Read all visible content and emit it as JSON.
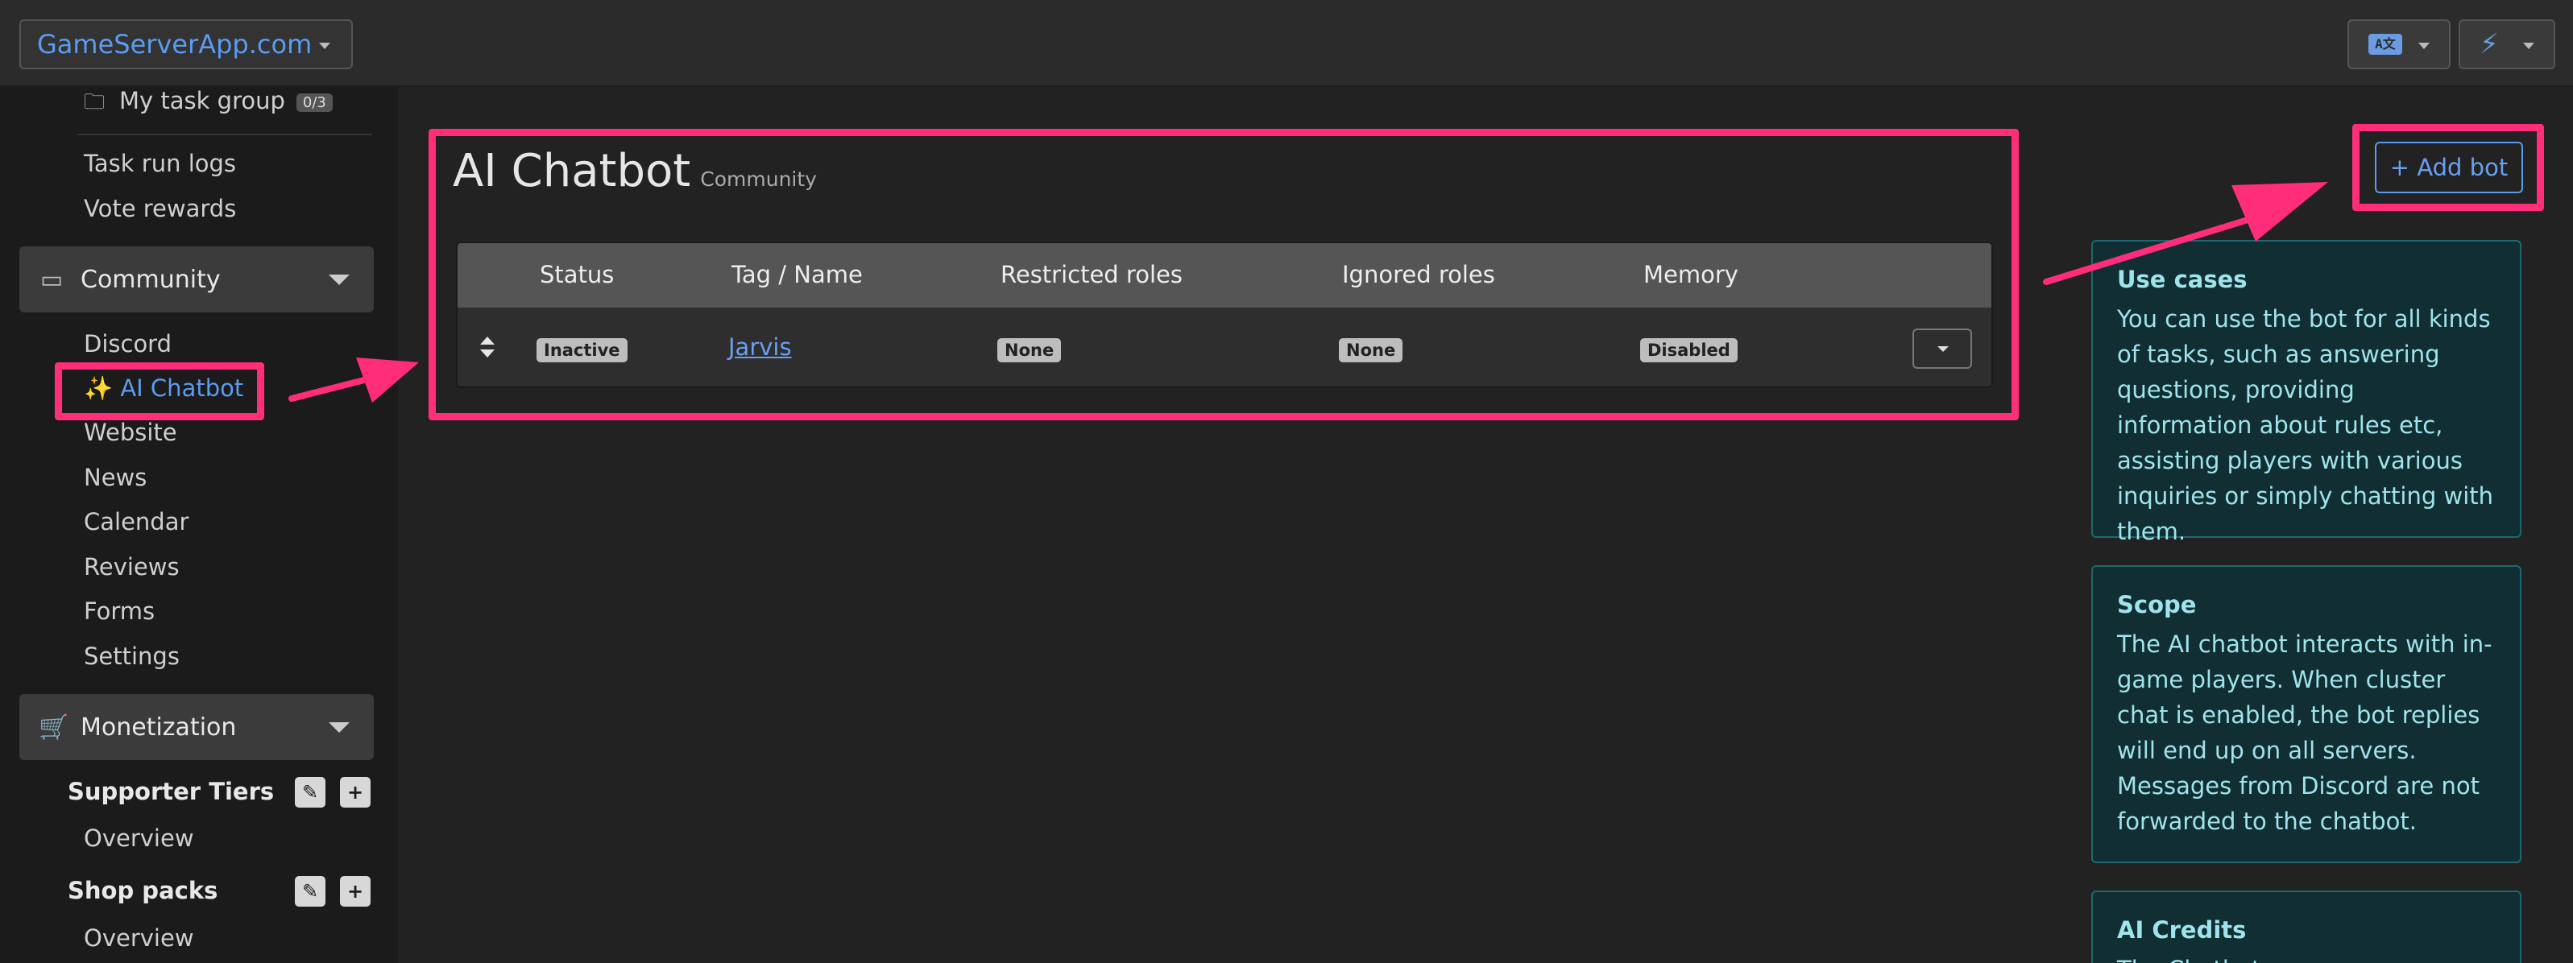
{
  "topbar": {
    "brand": "GameServerApp.com",
    "lang_icon": "translate-icon",
    "tools_icon": "magic-wand-icon"
  },
  "sidebar": {
    "task_group": {
      "label": "My task group",
      "badge": "0/3"
    },
    "items_top": [
      "Task run logs",
      "Vote rewards"
    ],
    "community": {
      "label": "Community",
      "items": [
        "Discord",
        "✨ AI Chatbot",
        "Website",
        "News",
        "Calendar",
        "Reviews",
        "Forms",
        "Settings"
      ]
    },
    "monetization": {
      "label": "Monetization",
      "supporter_tiers": {
        "label": "Supporter Tiers",
        "overview": "Overview"
      },
      "shop_packs": {
        "label": "Shop packs",
        "overview": "Overview"
      }
    }
  },
  "main": {
    "title": "AI Chatbot",
    "subtitle": "Community",
    "add_bot": "+ Add bot",
    "table": {
      "headers": [
        "Status",
        "Tag / Name",
        "Restricted roles",
        "Ignored roles",
        "Memory"
      ],
      "rows": [
        {
          "status": "Inactive",
          "name": "Jarvis",
          "restricted_roles": "None",
          "ignored_roles": "None",
          "memory": "Disabled"
        }
      ]
    }
  },
  "info_boxes": [
    {
      "title": "Use cases",
      "text": "You can use the bot for all kinds of tasks, such as answering questions, providing information about rules etc, assisting players with various inquiries or simply chatting with them."
    },
    {
      "title": "Scope",
      "text": "The AI chatbot interacts with in-game players. When cluster chat is enabled, the bot replies will end up on all servers. Messages from Discord are not forwarded to the chatbot."
    },
    {
      "title": "AI Credits",
      "text": "The Chatbot"
    }
  ],
  "colors": {
    "accent": "#5b9bf0",
    "highlight": "#ff2d7a",
    "info_bg": "#112e33",
    "info_text": "#9fe4ec"
  }
}
